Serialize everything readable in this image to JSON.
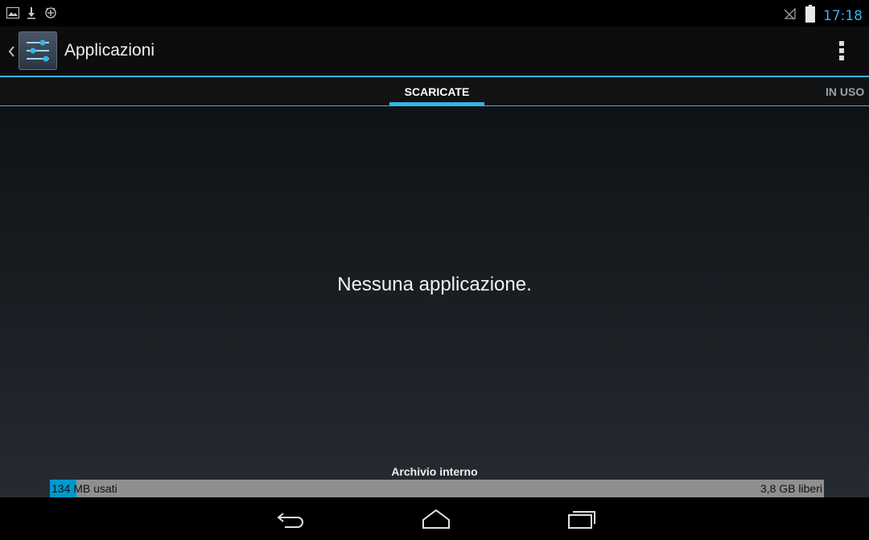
{
  "status_bar": {
    "time": "17:18",
    "left_icons": [
      "image-icon",
      "download-icon",
      "usb-debug-icon"
    ],
    "right_icons": [
      "signal-off-icon",
      "battery-icon"
    ],
    "accent": "#33b5e5"
  },
  "action_bar": {
    "title": "Applicazioni",
    "app_icon": "settings-sliders-icon",
    "overflow_icon": "overflow-menu-icon"
  },
  "tabs": [
    {
      "label": "SCARICATE",
      "selected": true
    },
    {
      "label": "IN USO",
      "selected": false
    }
  ],
  "content": {
    "empty_message": "Nessuna applicazione."
  },
  "storage": {
    "label": "Archivio interno",
    "used_number": "134",
    "used_suffix": " MB usati",
    "free_text": "3,8 GB liberi",
    "used_fraction": 0.034,
    "fill_color": "#0099cc"
  },
  "nav_bar": {
    "buttons": [
      "back-icon",
      "home-icon",
      "recent-apps-icon"
    ]
  }
}
